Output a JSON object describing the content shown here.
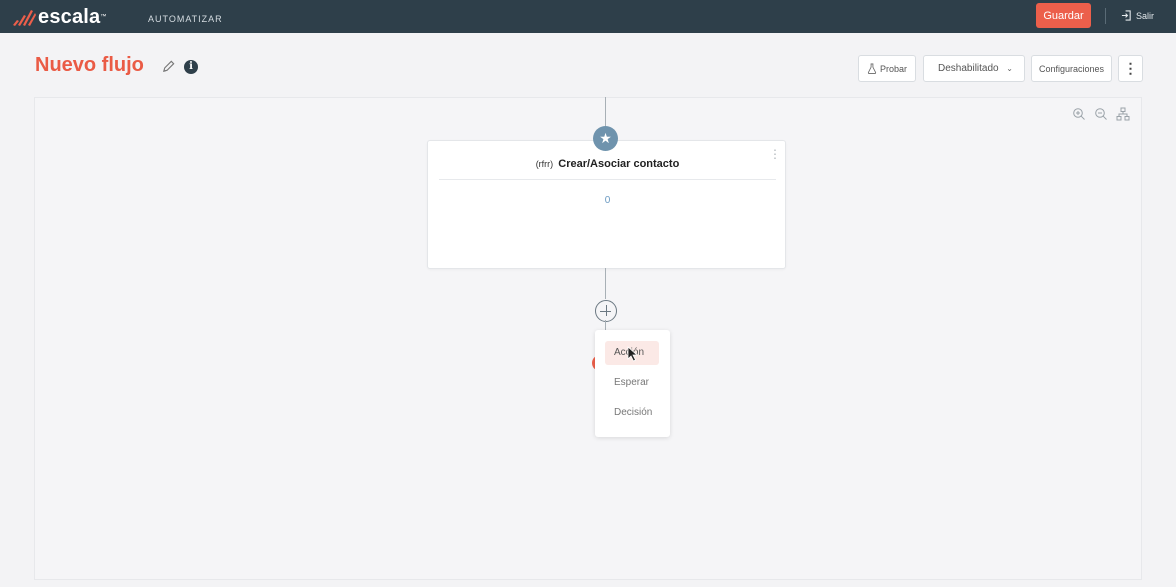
{
  "topbar": {
    "brand": "escala",
    "brand_tm": "™",
    "section": "AUTOMATIZAR",
    "save_label": "Guardar",
    "exit_label": "Salir"
  },
  "header": {
    "flow_title": "Nuevo flujo",
    "test_label": "Probar",
    "status_value": "Deshabilitado",
    "config_label": "Configuraciones",
    "more_label": "⋮"
  },
  "node": {
    "prefix": "(rfrr)",
    "title": "Crear/Asociar contacto",
    "count": "0"
  },
  "add_menu": {
    "items": [
      {
        "label": "Acción"
      },
      {
        "label": "Esperar"
      },
      {
        "label": "Decisión"
      }
    ]
  },
  "colors": {
    "topbar": "#2e3f4a",
    "accent": "#ec5f4b",
    "title": "#ea5b45",
    "node_badge": "#6f93ad"
  }
}
